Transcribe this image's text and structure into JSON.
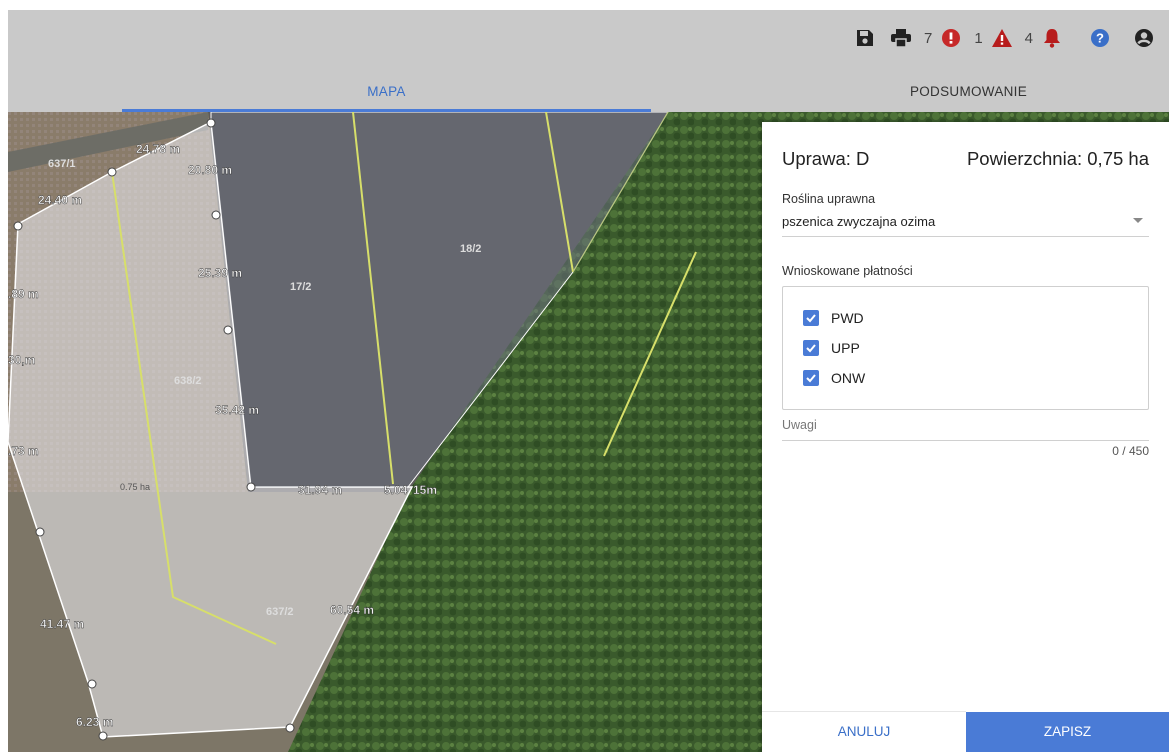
{
  "toolbar": {
    "icons": [
      "save-icon",
      "print-icon",
      "error-icon",
      "warning-icon",
      "bell-icon",
      "help-icon",
      "user-icon"
    ],
    "error_count": "7",
    "warning_count": "1",
    "notification_count": "4",
    "colors": {
      "error": "#c62828",
      "warning": "#b71c1c",
      "help": "#3a6fc8",
      "icon": "#222222"
    }
  },
  "tabs": [
    {
      "label": "MAPA",
      "active": true
    },
    {
      "label": "PODSUMOWANIE",
      "active": false
    }
  ],
  "map": {
    "parcel_labels": [
      "637/1",
      "638/2",
      "17/2",
      "18/2",
      "637/2"
    ],
    "area_label": "0.75 ha",
    "measurements": [
      "24.78 m",
      "20.80 m",
      "24.40 m",
      "25.39 m",
      "35.42 m",
      "31.94 m",
      "5.04",
      "15m",
      "60.54 m",
      "41.47 m",
      "6.23 m",
      ".89 m",
      "30,m",
      ".73 m"
    ]
  },
  "panel": {
    "title": "Uprawa: D",
    "area": "Powierzchnia: 0,75 ha",
    "crop_label": "Roślina uprawna",
    "crop_value": "pszenica zwyczajna ozima",
    "payments_label": "Wnioskowane płatności",
    "payments": [
      {
        "label": "PWD",
        "checked": true
      },
      {
        "label": "UPP",
        "checked": true
      },
      {
        "label": "ONW",
        "checked": true
      }
    ],
    "notes_placeholder": "Uwagi",
    "notes_counter": "0 / 450",
    "cancel_label": "ANULUJ",
    "save_label": "ZAPISZ",
    "accent_color": "#4a7bd6"
  }
}
